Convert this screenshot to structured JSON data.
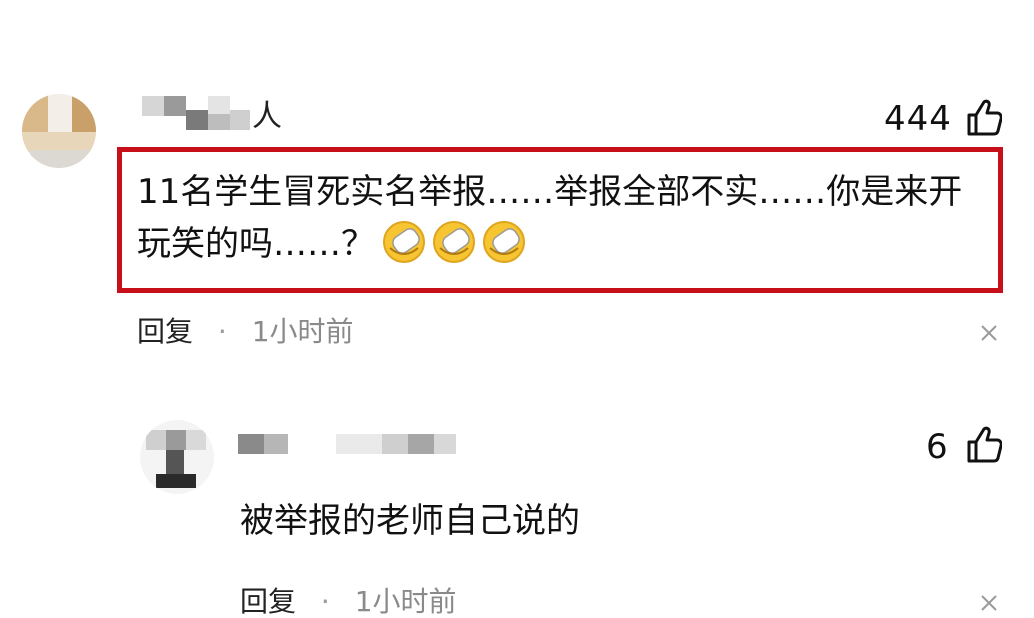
{
  "comments": [
    {
      "username_visible_char": "人",
      "likes": "444",
      "text_line1": "11名学生冒死实名举报……举报全部不实……你是来开",
      "text_line2": "玩笑的吗……？",
      "emoji_name": "facepalm-emoji",
      "emoji_count": 3,
      "reply_label": "回复",
      "separator": "·",
      "time": "1小时前"
    },
    {
      "likes": "6",
      "text": "被举报的老师自己说的",
      "reply_label": "回复",
      "separator": "·",
      "time": "1小时前"
    }
  ],
  "icons": {
    "like": "thumbs-up-icon",
    "close": "close-icon"
  },
  "colors": {
    "highlight_border": "#c8101a",
    "meta_gray": "#8a8a8a"
  }
}
